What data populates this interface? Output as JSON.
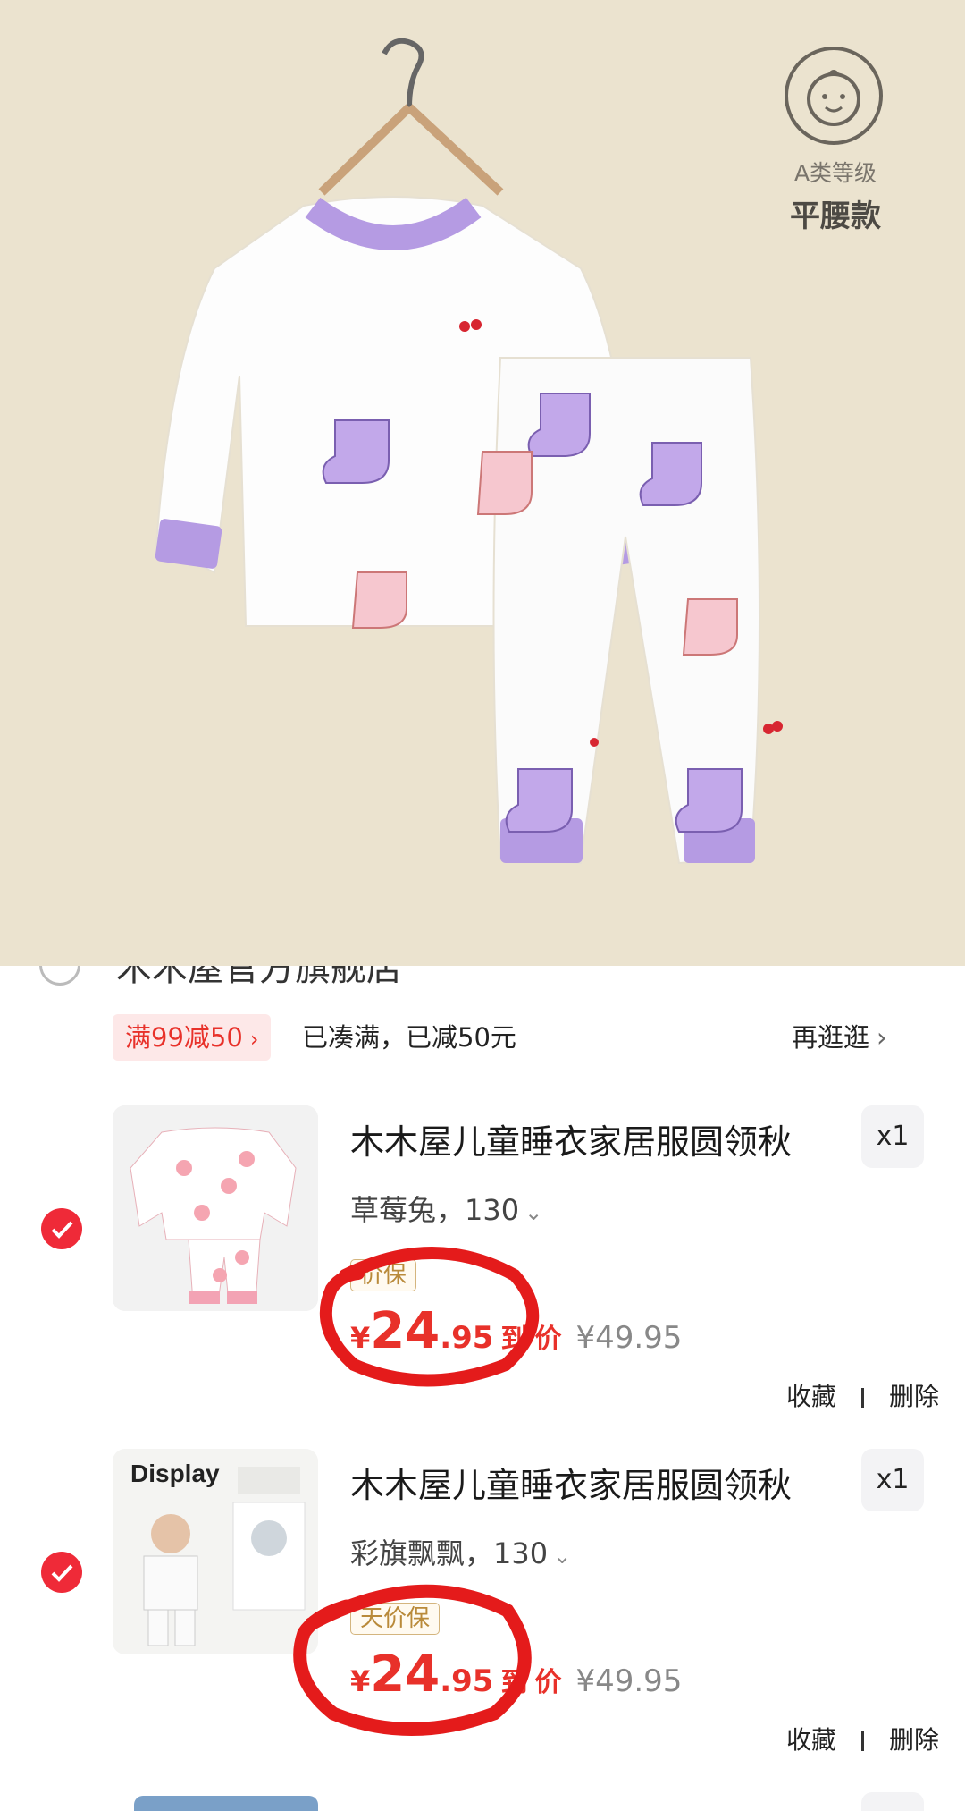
{
  "hero": {
    "badge": {
      "icon": "baby-face-icon",
      "grade": "A类等级",
      "style": "平腰款"
    }
  },
  "store": {
    "name": "木木屋官方旗舰店"
  },
  "promo": {
    "tag": "满99减50",
    "text": "已凑满，已减50元",
    "more": "再逛逛"
  },
  "items": [
    {
      "title": "木木屋儿童睡衣家居服圆领秋",
      "qty": "x1",
      "spec": "草莓兔，130",
      "tag": "价保",
      "price_currency": "¥",
      "price_int": "24",
      "price_dec": ".95",
      "price_suffix": "到",
      "price_label": "价",
      "original_price": "¥49.95",
      "action_fav": "收藏",
      "action_delete": "删除"
    },
    {
      "title": "木木屋儿童睡衣家居服圆领秋",
      "qty": "x1",
      "spec": "彩旗飘飘，130",
      "tag": "天价保",
      "thumb_text": "Display",
      "price_currency": "¥",
      "price_int": "24",
      "price_dec": ".95",
      "price_suffix": "到",
      "price_label": "价",
      "original_price": "¥49.95",
      "action_fav": "收藏",
      "action_delete": "删除"
    }
  ],
  "colors": {
    "accent": "#e8312a",
    "check": "#ef2a38",
    "hero_bg": "#ebe3cf",
    "trim": "#b59be3"
  }
}
